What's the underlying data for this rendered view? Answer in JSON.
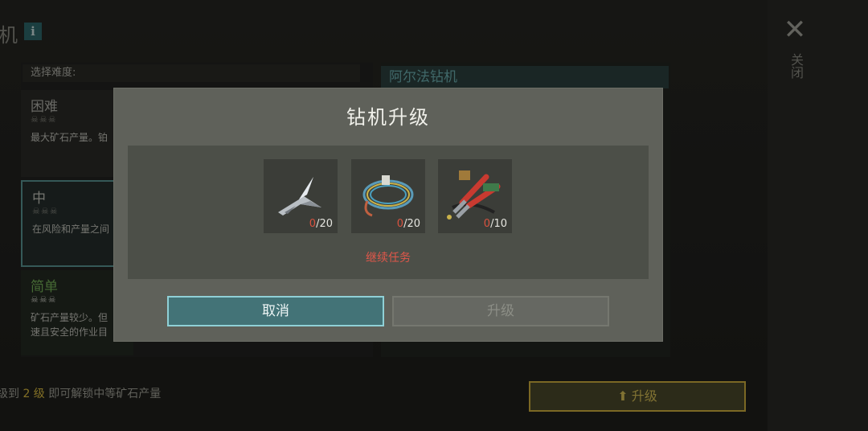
{
  "background": {
    "page_title": "机",
    "info_icon": "i",
    "close_label": "关闭",
    "difficulty_header": "选择难度:",
    "difficulties": [
      {
        "name": "困难",
        "skulls": "☠☠☠",
        "desc": "最大矿石产量。铂"
      },
      {
        "name": "中",
        "skulls": "☠☠☠",
        "desc": "在风险和产量之间"
      },
      {
        "name": "简单",
        "skulls": "☠☠☠",
        "desc_line1": "矿石产量较少。但",
        "desc_line2": "速且安全的作业目"
      }
    ],
    "drill_name": "阿尔法钻机",
    "footer_prefix": "级到",
    "footer_level": "2 级",
    "footer_suffix": "即可解锁中等矿石产量",
    "upgrade_button": "升级"
  },
  "modal": {
    "title": "钻机升级",
    "items": [
      {
        "icon": "metal-shards-icon",
        "have": "0",
        "need": "/20"
      },
      {
        "icon": "wire-coil-icon",
        "have": "0",
        "need": "/20"
      },
      {
        "icon": "pliers-icon",
        "have": "0",
        "need": "/10"
      }
    ],
    "mission_link": "继续任务",
    "cancel_button": "取消",
    "upgrade_button": "升级"
  },
  "colors": {
    "accent_teal": "#437377",
    "warning_red": "#d9523f",
    "gold": "#d4b33e"
  }
}
